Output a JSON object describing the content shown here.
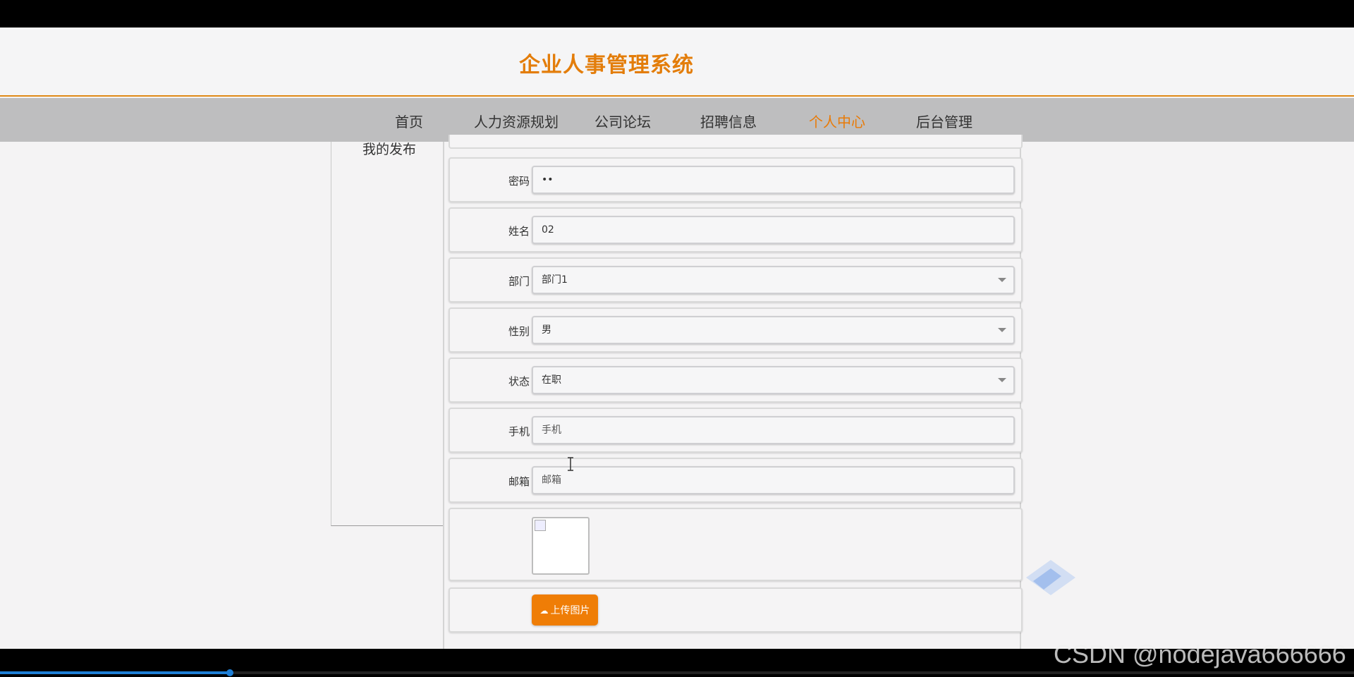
{
  "header": {
    "title": "企业人事管理系统"
  },
  "nav": {
    "items": [
      {
        "label": "首页",
        "active": false
      },
      {
        "label": "人力资源规划",
        "active": false
      },
      {
        "label": "公司论坛",
        "active": false
      },
      {
        "label": "招聘信息",
        "active": false
      },
      {
        "label": "个人中心",
        "active": true
      },
      {
        "label": "后台管理",
        "active": false
      }
    ]
  },
  "sidebar": {
    "items": [
      {
        "label": "我的发布"
      }
    ]
  },
  "form": {
    "password": {
      "label": "密码",
      "value": "••"
    },
    "name": {
      "label": "姓名",
      "value": "02"
    },
    "department": {
      "label": "部门",
      "value": "部门1"
    },
    "gender": {
      "label": "性别",
      "value": "男"
    },
    "status": {
      "label": "状态",
      "value": "在职"
    },
    "phone": {
      "label": "手机",
      "placeholder": "手机"
    },
    "email": {
      "label": "邮箱",
      "placeholder": "邮箱"
    },
    "upload_label": "上传图片"
  },
  "video": {
    "progress_fraction": 0.17
  },
  "watermark": "CSDN @nodejava666666",
  "colors": {
    "accent": "#ef7d06",
    "brand": "#e37d0a"
  }
}
